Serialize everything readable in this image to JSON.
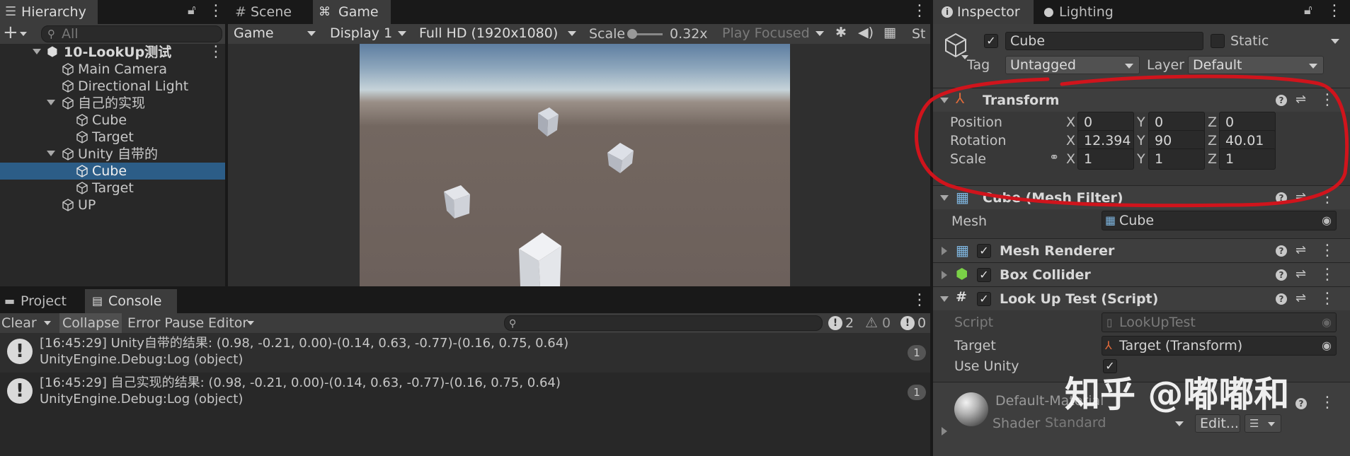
{
  "hierarchy": {
    "tab": "Hierarchy",
    "search_placeholder": "All",
    "scene_name": "10-LookUp测试",
    "items": [
      {
        "label": "Main Camera"
      },
      {
        "label": "Directional Light"
      },
      {
        "label": "自己的实现"
      },
      {
        "label": "Cube"
      },
      {
        "label": "Target"
      },
      {
        "label": "Unity 自带的"
      },
      {
        "label": "Cube"
      },
      {
        "label": "Target"
      },
      {
        "label": "UP"
      }
    ]
  },
  "game_view": {
    "tabs": [
      "Scene",
      "Game"
    ],
    "toolbar": {
      "mode": "Game",
      "display": "Display 1",
      "resolution": "Full HD (1920x1080)",
      "scale_label": "Scale",
      "scale_value": "0.32x",
      "play_mode": "Play Focused",
      "stats_label": "St"
    }
  },
  "console": {
    "tabs": [
      "Project",
      "Console"
    ],
    "toolbar": {
      "clear": "Clear",
      "collapse": "Collapse",
      "error_pause": "Error Pause",
      "editor": "Editor",
      "log_count": "2",
      "warn_count": "0",
      "error_count": "0"
    },
    "entries": [
      {
        "line1": "[16:45:29] Unity自带的结果: (0.98, -0.21, 0.00)-(0.14, 0.63, -0.77)-(0.16, 0.75, 0.64)",
        "line2": "UnityEngine.Debug:Log (object)",
        "count": "1"
      },
      {
        "line1": "[16:45:29] 自己实现的结果: (0.98, -0.21, 0.00)-(0.14, 0.63, -0.77)-(0.16, 0.75, 0.64)",
        "line2": "UnityEngine.Debug:Log (object)",
        "count": "1"
      }
    ]
  },
  "inspector": {
    "tabs": [
      "Inspector",
      "Lighting"
    ],
    "object_name": "Cube",
    "static_label": "Static",
    "tag_label": "Tag",
    "tag_value": "Untagged",
    "layer_label": "Layer",
    "layer_value": "Default",
    "transform": {
      "title": "Transform",
      "position_label": "Position",
      "rotation_label": "Rotation",
      "scale_label": "Scale",
      "axes": [
        "X",
        "Y",
        "Z"
      ],
      "position": [
        "0",
        "0",
        "0"
      ],
      "rotation": [
        "12.394",
        "90",
        "40.01"
      ],
      "scale": [
        "1",
        "1",
        "1"
      ]
    },
    "mesh_filter": {
      "title": "Cube (Mesh Filter)",
      "mesh_label": "Mesh",
      "mesh_value": "Cube"
    },
    "mesh_renderer": {
      "title": "Mesh Renderer"
    },
    "box_collider": {
      "title": "Box Collider"
    },
    "script_component": {
      "title": "Look Up Test (Script)",
      "script_label": "Script",
      "script_value": "LookUpTest",
      "target_label": "Target",
      "target_value": "Target (Transform)",
      "use_unity_label": "Use Unity"
    },
    "material": {
      "name": "Default-Material",
      "shader_label": "Shader",
      "shader_value": "Standard",
      "edit_button": "Edit..."
    },
    "watermark": "知乎 @嘟嘟和"
  },
  "colors": {
    "selection": "#2c5d87",
    "annotation": "#d0141c",
    "sky_top": "#5e7ea1",
    "ground": "#6c605b"
  }
}
